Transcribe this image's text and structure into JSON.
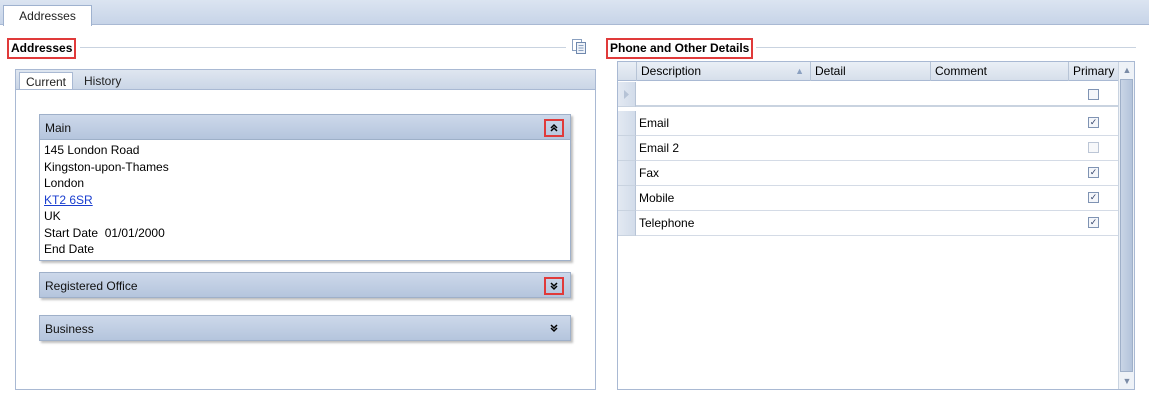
{
  "top_tab": {
    "label": "Addresses"
  },
  "addresses": {
    "title": "Addresses",
    "tabs": [
      {
        "label": "Current",
        "active": true
      },
      {
        "label": "History",
        "active": false
      }
    ],
    "groups": {
      "main": {
        "title": "Main",
        "expanded": true,
        "lines": [
          "145 London Road",
          "Kingston-upon-Thames",
          "London"
        ],
        "postcode": "KT2 6SR",
        "country": "UK",
        "start_date_label": "Start Date",
        "start_date_value": "01/01/2000",
        "end_date_label": "End Date"
      },
      "registered": {
        "title": "Registered Office",
        "expanded": false
      },
      "business": {
        "title": "Business",
        "expanded": false
      }
    }
  },
  "phone": {
    "title": "Phone and Other Details",
    "columns": [
      "Description",
      "Detail",
      "Comment",
      "Primary"
    ],
    "rows": [
      {
        "description": "Email",
        "primary": true
      },
      {
        "description": "Email 2",
        "primary": false
      },
      {
        "description": "Fax",
        "primary": true
      },
      {
        "description": "Mobile",
        "primary": true
      },
      {
        "description": "Telephone",
        "primary": true
      }
    ]
  },
  "icons": {
    "copy": "copy-icon",
    "collapse": "chevron-double-up-icon",
    "expand": "chevron-double-down-icon",
    "sort_asc": "sort-ascending-icon",
    "check": "✓"
  },
  "colors": {
    "highlight": "#e03a3a",
    "link": "#1a3ecf"
  }
}
